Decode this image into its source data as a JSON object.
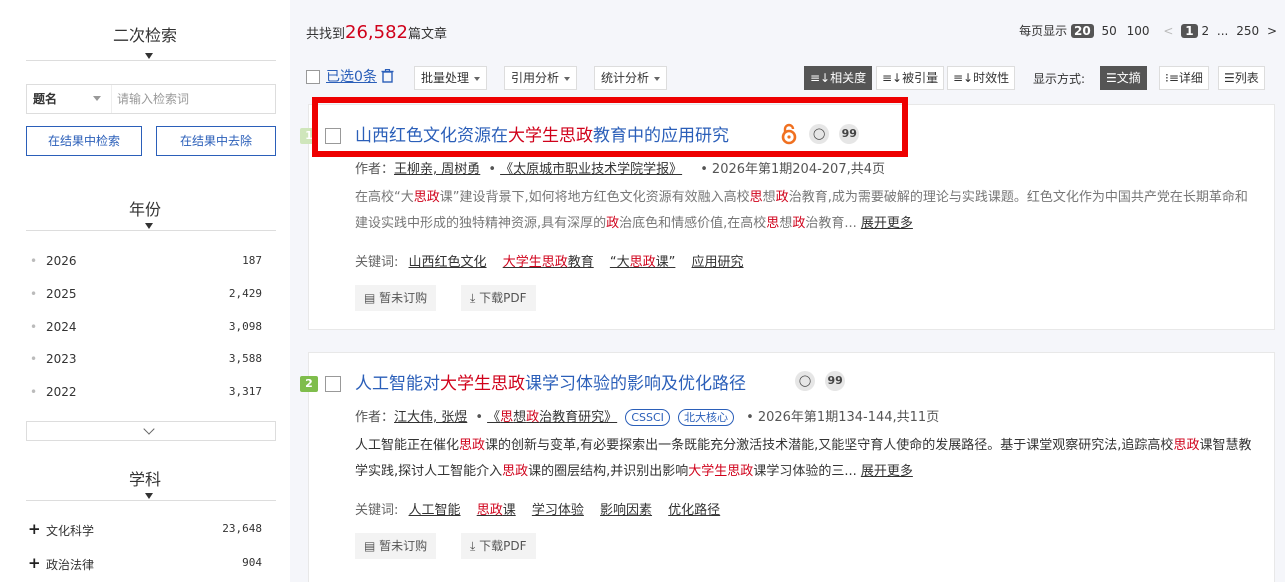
{
  "left": {
    "secondary_search": {
      "title": "二次检索",
      "field_label": "题名",
      "field_placeholder": "请输入检索词",
      "search_in_results": "在结果中检索",
      "exclude_from_results": "在结果中去除"
    },
    "year": {
      "title": "年份",
      "items": [
        {
          "label": "2026",
          "count": "187"
        },
        {
          "label": "2025",
          "count": "2,429"
        },
        {
          "label": "2024",
          "count": "3,098"
        },
        {
          "label": "2023",
          "count": "3,588"
        },
        {
          "label": "2022",
          "count": "3,317"
        }
      ]
    },
    "subject": {
      "title": "学科",
      "items": [
        {
          "label": "文化科学",
          "count": "23,648"
        },
        {
          "label": "政治法律",
          "count": "904"
        }
      ]
    }
  },
  "summary": {
    "prefix": "共找到",
    "count": "26,582",
    "suffix": "篇文章"
  },
  "pagination": {
    "per_page_label": "每页显示",
    "per_page_selected": "20",
    "per_page_options": [
      "50",
      "100"
    ],
    "current_page": "1",
    "next_page": "2",
    "ellipsis": "...",
    "last_page": "250",
    "prev": "<",
    "next": ">"
  },
  "toolbar": {
    "selected": "已选0条",
    "batch": "批量处理",
    "citation": "引用分析",
    "stats": "统计分析",
    "sort_relevance": "相关度",
    "sort_cited": "被引量",
    "sort_time": "时效性",
    "display_label": "显示方式:",
    "view_abstract": "文摘",
    "view_detail": "详细",
    "view_list": "列表"
  },
  "articles": [
    {
      "index": "1",
      "title_pre": "山西红色文化资源在",
      "title_hl": "大学生思政",
      "title_post": "教育中的应用研究",
      "author_label": "作者：",
      "authors": "王柳亲, 周树勇",
      "journal": "《太原城市职业技术学院学报》",
      "issue": "2026年第1期204-207,共4页",
      "abstract_p1": "在高校“大",
      "abstract_h1": "思政",
      "abstract_p2": "课”建设背景下,如何将地方红色文化资源有效融入高校",
      "abstract_h2": "思",
      "abstract_p3": "想",
      "abstract_h3": "政",
      "abstract_p4": "治教育,成为需要破解的理论与实践课题。红色文化作为中国共产党在长期革命和建设实践中形成的独特精神资源,具有深厚的",
      "abstract_h4": "政",
      "abstract_p5": "治底色和情感价值,在高校",
      "abstract_h5": "思",
      "abstract_p6": "想",
      "abstract_h6": "政",
      "abstract_p7": "治教育... ",
      "more": "展开更多",
      "kw_label": "关键词:",
      "kw1": "山西红色文化",
      "kw2_hl": "大学生思政",
      "kw2_post": "教育",
      "kw3_pre": "“大",
      "kw3_hl": "思政",
      "kw3_post": "课”",
      "kw4": "应用研究",
      "act1": "暂未订购",
      "act2": "下载PDF"
    },
    {
      "index": "2",
      "title_pre": "人工智能对",
      "title_hl": "大学生思政",
      "title_post": "课学习体验的影响及优化路径",
      "author_label": "作者：",
      "authors": "江大伟, 张煜",
      "journal_pre": "《",
      "journal_h1": "思",
      "journal_mid": "想",
      "journal_h2": "政",
      "journal_post": "治教育研究》",
      "badge1": "CSSCI",
      "badge2": "北大核心",
      "issue": "2026年第1期134-144,共11页",
      "abstract_p1": "人工智能正在催化",
      "abstract_h1": "思政",
      "abstract_p2": "课的创新与变革,有必要探索出一条既能充分激活技术潜能,又能坚守育人使命的发展路径。基于课堂观察研究法,追踪高校",
      "abstract_h2": "思政",
      "abstract_p3": "课智慧教学实践,探讨人工智能介入",
      "abstract_h3": "思政",
      "abstract_p4": "课的圈层结构,并识别出影响",
      "abstract_h4": "大学生思政",
      "abstract_p5": "课学习体验的三... ",
      "more": "展开更多",
      "kw_label": "关键词:",
      "kw1": "人工智能",
      "kw2_hl": "思政",
      "kw2_post": "课",
      "kw3": "学习体验",
      "kw4": "影响因素",
      "kw5": "优化路径",
      "act1": "暂未订购",
      "act2": "下载PDF"
    }
  ],
  "colors": {
    "accent": "#2b5fb9",
    "highlight": "#d0021b",
    "annotation_box": "#ee0000",
    "index_badge": "#7fbd4c",
    "oa_icon": "#f07020"
  },
  "icons": [
    "dropdown-triangle-icon",
    "chevron-down-icon",
    "plus-icon",
    "open-access-icon",
    "author-icon",
    "quote-icon",
    "unsubscribed-icon",
    "download-icon",
    "sort-icon",
    "abstract-view-icon",
    "detail-view-icon",
    "list-view-icon",
    "trash-icon"
  ]
}
